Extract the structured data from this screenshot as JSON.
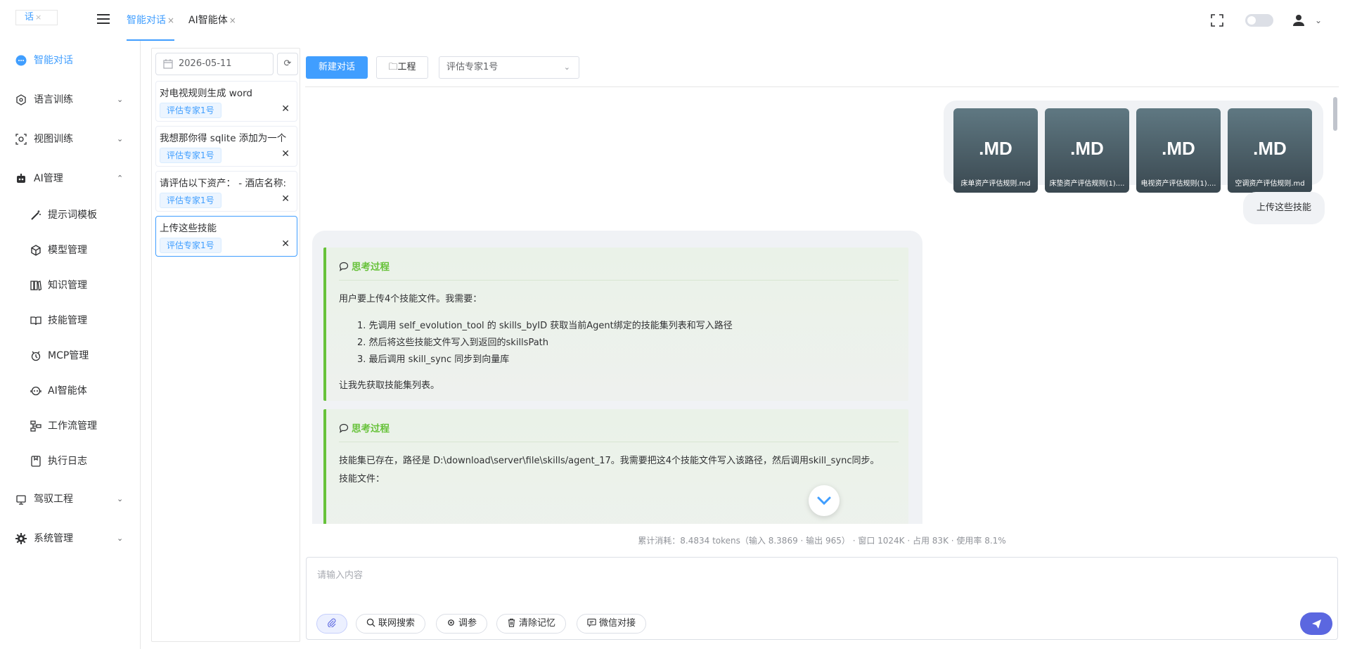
{
  "header": {
    "logo_text": "话",
    "tabs": [
      {
        "label": "智能对话",
        "active": true
      },
      {
        "label": "AI智能体",
        "active": false
      }
    ]
  },
  "sidebar": {
    "items": [
      {
        "label": "智能对话",
        "icon": "chat-bubble-icon",
        "active": true
      },
      {
        "label": "语言训练",
        "icon": "language-icon"
      },
      {
        "label": "视图训练",
        "icon": "vision-icon"
      },
      {
        "label": "AI管理",
        "icon": "robot-icon",
        "expanded": true
      },
      {
        "label": "驾驭工程",
        "icon": "steering-icon"
      },
      {
        "label": "系统管理",
        "icon": "gear-icon"
      }
    ],
    "sub_items": [
      {
        "label": "提示词模板",
        "icon": "magic-wand-icon"
      },
      {
        "label": "模型管理",
        "icon": "cube-icon"
      },
      {
        "label": "知识管理",
        "icon": "book-icon"
      },
      {
        "label": "技能管理",
        "icon": "skill-book-icon"
      },
      {
        "label": "MCP管理",
        "icon": "mcp-icon"
      },
      {
        "label": "AI智能体",
        "icon": "agent-icon"
      },
      {
        "label": "工作流管理",
        "icon": "workflow-icon"
      },
      {
        "label": "执行日志",
        "icon": "log-icon"
      }
    ]
  },
  "conversations": {
    "date": "2026-05-11",
    "items": [
      {
        "title": "对电视规则生成 word",
        "tag": "评估专家1号"
      },
      {
        "title": "我想那你得 sqlite 添加为一个",
        "tag": "评估专家1号"
      },
      {
        "title": "请评估以下资产：  - 酒店名称:",
        "tag": "评估专家1号"
      },
      {
        "title": "上传这些技能",
        "tag": "评估专家1号",
        "selected": true
      }
    ]
  },
  "toolbar": {
    "new_chat": "新建对话",
    "project": "工程",
    "agent_select": "评估专家1号"
  },
  "messages": {
    "files": [
      {
        "ext": ".MD",
        "name": "床单资产评估规则.md"
      },
      {
        "ext": ".MD",
        "name": "床垫资产评估规则(1)...."
      },
      {
        "ext": ".MD",
        "name": "电视资产评估规则(1)...."
      },
      {
        "ext": ".MD",
        "name": "空调资产评估规则.md"
      }
    ],
    "user_text": "上传这些技能",
    "think1": {
      "title": "思考过程",
      "intro": "用户要上传4个技能文件。我需要：",
      "steps": [
        "1. 先调用 self_evolution_tool 的 skills_byID 获取当前Agent绑定的技能集列表和写入路径",
        "2. 然后将这些技能文件写入到返回的skillsPath",
        "3. 最后调用 skill_sync 同步到向量库"
      ],
      "outro": "让我先获取技能集列表。"
    },
    "think2": {
      "title": "思考过程",
      "line1": "技能集已存在，路径是 D:\\download\\server\\file\\skills/agent_17。我需要把这4个技能文件写入该路径，然后调用skill_sync同步。",
      "line2": "技能文件："
    }
  },
  "usage": "累计消耗：8.4834 tokens（输入 8.3869 · 输出 965） · 窗口 1024K · 占用 83K · 使用率 8.1%",
  "input": {
    "placeholder": "请输入内容",
    "tools": [
      "联网搜索",
      "调参",
      "清除记忆",
      "微信对接"
    ]
  },
  "colors": {
    "accent": "#409eff",
    "think_border": "#67c23a",
    "send": "#5b67e0"
  }
}
